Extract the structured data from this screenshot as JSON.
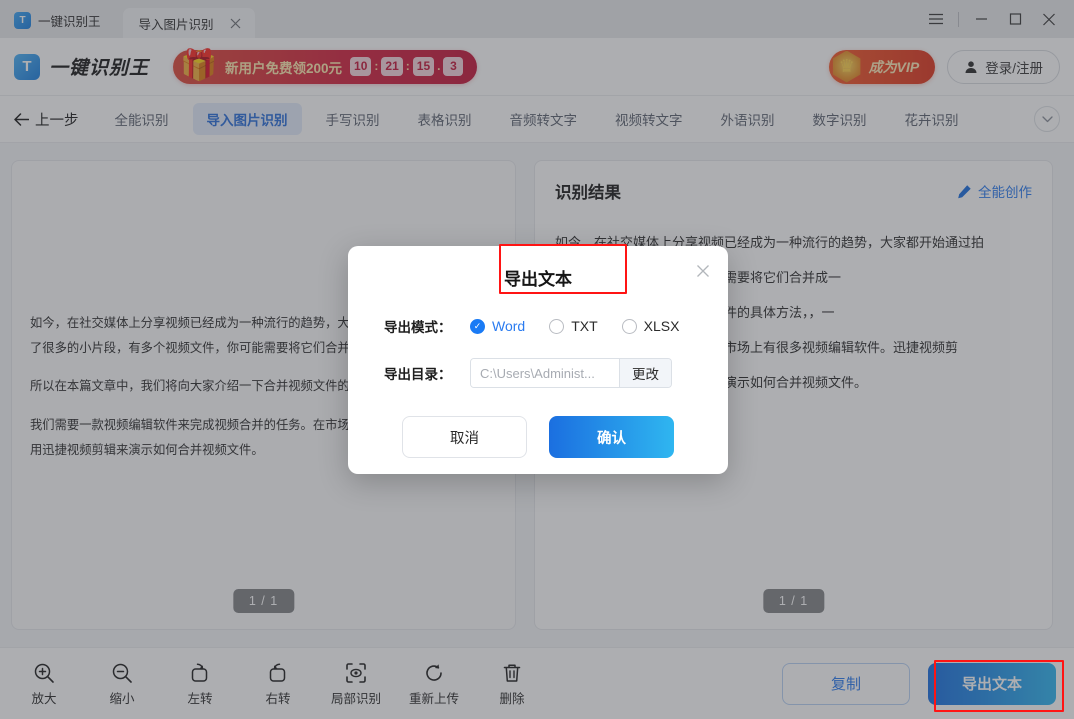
{
  "titlebar": {
    "app_name": "一键识别王",
    "tab_label": "导入图片识别",
    "close_tab_icon": "close-icon",
    "menu_icon": "hamburger-menu-icon",
    "minimize_icon": "minimize-icon",
    "maximize_icon": "maximize-icon",
    "close_icon": "close-icon"
  },
  "header": {
    "brand": "一键识别王",
    "promo_text": "新用户免费领200元",
    "countdown": {
      "hours": "10",
      "minutes": "21",
      "seconds": "15",
      "tenths": "3",
      "sep": ":",
      "dot": "."
    },
    "vip_label": "成为VIP",
    "login_label": "登录/注册"
  },
  "nav": {
    "back_label": "上一步",
    "back_icon": "arrow-left-icon",
    "more_icon": "chevron-down-icon",
    "tabs": [
      {
        "label": "全能识别",
        "active": false
      },
      {
        "label": "导入图片识别",
        "active": true
      },
      {
        "label": "手写识别",
        "active": false
      },
      {
        "label": "表格识别",
        "active": false
      },
      {
        "label": "音频转文字",
        "active": false
      },
      {
        "label": "视频转文字",
        "active": false
      },
      {
        "label": "外语识别",
        "active": false
      },
      {
        "label": "数字识别",
        "active": false
      },
      {
        "label": "花卉识别",
        "active": false
      }
    ]
  },
  "left_panel": {
    "page_indicator": "1 / 1",
    "paragraphs": [
      "如今，在社交媒体上分享视频已经成为一种流行的趋势，大家都开始通过拍如果你拍摄了很多的小片段，有多个视频文件，你可能需要将它们合并成一个的内容。",
      "所以在本篇文章中，我们将向大家介绍一下合并视频文件的具体方法，",
      "我们需要一款视频编辑软件来完成视频合并的任务。在市场上有很多视频编中，我将使用迅捷视频剪辑来演示如何合并视频文件。"
    ]
  },
  "right_panel": {
    "title": "识别结果",
    "create_label": "全能创作",
    "create_icon": "pencil-icon",
    "page_indicator": "1 / 1",
    "paragraphs": [
      "如今，在社交媒体上分享视频已经成为一种流行的趋势，大家都开始通过拍",
      "段，有多个视频文件，你可能需要将它们合并成一",
      "将向大家介绍一下合并视频文件的具体方法，，一",
      "件来完成视频合并的任务。在市场上有很多视频编辑软件。迅捷视频剪",
      "中，我将使用迅捷视频剪辑来演示如何合并视频文件。"
    ]
  },
  "toolbar": {
    "tools": [
      {
        "label": "放大",
        "icon": "zoom-in-icon"
      },
      {
        "label": "缩小",
        "icon": "zoom-out-icon"
      },
      {
        "label": "左转",
        "icon": "rotate-left-icon"
      },
      {
        "label": "右转",
        "icon": "rotate-right-icon"
      },
      {
        "label": "局部识别",
        "icon": "crop-scan-icon"
      },
      {
        "label": "重新上传",
        "icon": "refresh-upload-icon"
      },
      {
        "label": "删除",
        "icon": "trash-icon"
      }
    ],
    "copy_label": "复制",
    "export_label": "导出文本"
  },
  "modal": {
    "title": "导出文本",
    "close_icon": "close-icon",
    "mode_label": "导出模式：",
    "modes": [
      {
        "label": "Word",
        "selected": true
      },
      {
        "label": "TXT",
        "selected": false
      },
      {
        "label": "XLSX",
        "selected": false
      }
    ],
    "dir_label": "导出目录：",
    "dir_placeholder": "C:\\Users\\Administ...",
    "dir_value": "",
    "change_label": "更改",
    "cancel_label": "取消",
    "confirm_label": "确认"
  },
  "colors": {
    "accent_blue": "#2a7bf0",
    "gradient_blue_start": "#1b6fe0",
    "gradient_blue_end": "#2fb6f0",
    "promo_red": "#c5183c",
    "vip_orange": "#e0361f",
    "highlight_red": "#ff1414"
  }
}
